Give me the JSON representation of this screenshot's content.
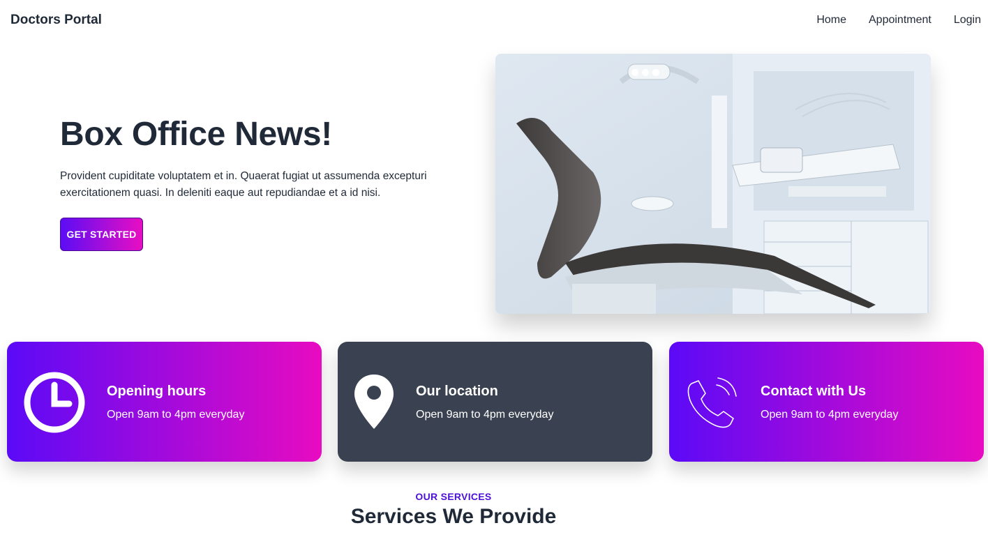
{
  "navbar": {
    "brand": "Doctors Portal",
    "links": [
      "Home",
      "Appointment",
      "Login"
    ]
  },
  "hero": {
    "title": "Box Office News!",
    "text": "Provident cupiditate voluptatem et in. Quaerat fugiat ut assumenda excepturi exercitationem quasi. In deleniti eaque aut repudiandae et a id nisi.",
    "cta_label": "GET STARTED",
    "image_icon": "dental-chair-photo"
  },
  "info_cards": [
    {
      "icon": "clock-icon",
      "title": "Opening hours",
      "text": "Open 9am to 4pm everyday",
      "style": "gradient"
    },
    {
      "icon": "location-pin-icon",
      "title": "Our location",
      "text": "Open 9am to 4pm everyday",
      "style": "dark"
    },
    {
      "icon": "phone-icon",
      "title": "Contact with Us",
      "text": "Open 9am to 4pm everyday",
      "style": "gradient"
    }
  ],
  "services": {
    "kicker": "OUR SERVICES",
    "title": "Services We Provide"
  },
  "colors": {
    "gradient_start": "#5b0af7",
    "gradient_end": "#e80bc1",
    "dark_card": "#3a4150",
    "accent_text": "#4d10d6",
    "text": "#1f2937"
  }
}
